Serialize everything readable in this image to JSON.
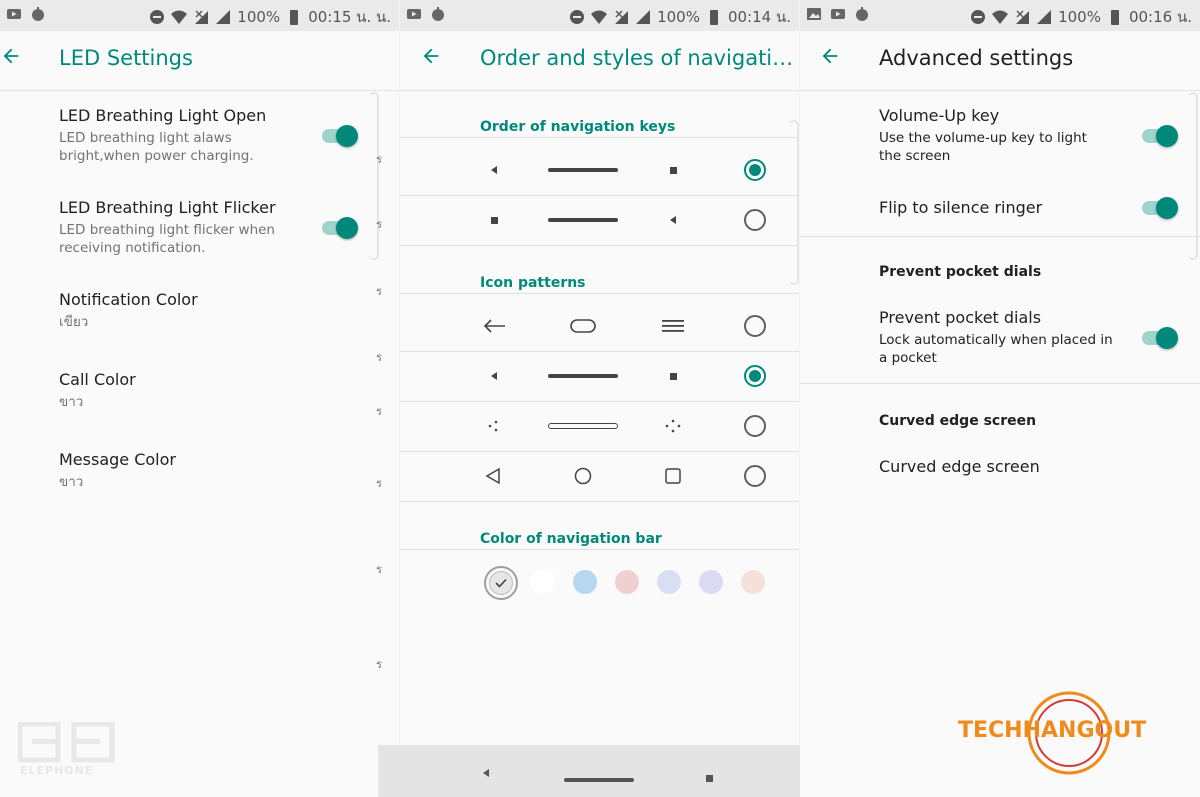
{
  "status_bars": [
    {
      "battery": "100%",
      "time": "00:15 น. น."
    },
    {
      "battery": "100%",
      "time": "00:14 น."
    },
    {
      "battery": "100%",
      "time": "00:16 น."
    }
  ],
  "led_panel": {
    "title": "LED Settings",
    "items": [
      {
        "title": "LED Breathing Light Open",
        "subtitle": "LED breathing light alaws bright,when power charging.",
        "toggle": true
      },
      {
        "title": "LED Breathing Light Flicker",
        "subtitle": "LED breathing light flicker when receiving notification.",
        "toggle": true
      },
      {
        "title": "Notification Color",
        "subtitle": "เขียว"
      },
      {
        "title": "Call Color",
        "subtitle": "ขาว"
      },
      {
        "title": "Message Color",
        "subtitle": "ขาว"
      }
    ],
    "side_marks": [
      "ร",
      "ร",
      "ร",
      "ร",
      "ร",
      "ร",
      "ร",
      "ร"
    ]
  },
  "nav_panel": {
    "title": "Order and styles of navigati…",
    "order_heading": "Order of navigation keys",
    "icon_heading": "Icon patterns",
    "color_heading": "Color of navigation bar",
    "order_options": [
      {
        "selected": true,
        "icons": [
          "triangle-left-small",
          "long-bar",
          "square-small"
        ]
      },
      {
        "selected": false,
        "icons": [
          "square-small",
          "long-bar",
          "triangle-left-small"
        ]
      }
    ],
    "pattern_options": [
      {
        "selected": false,
        "icons": [
          "arrow-left",
          "pill",
          "hamburger"
        ]
      },
      {
        "selected": true,
        "icons": [
          "triangle-left-small",
          "long-bar",
          "square-small"
        ]
      },
      {
        "selected": false,
        "icons": [
          "dots-three",
          "outline-bar",
          "dots-four"
        ]
      },
      {
        "selected": false,
        "icons": [
          "triangle-outline",
          "circle-outline",
          "square-outline"
        ]
      }
    ],
    "colors": [
      "#e8e8e8",
      "#ffffff",
      "#b5d7f2",
      "#eed0d0",
      "#d9dff2",
      "#dcdaf3",
      "#f4e1d9"
    ]
  },
  "advanced_panel": {
    "title": "Advanced settings",
    "items": [
      {
        "title": "Volume-Up key",
        "subtitle": "Use the volume-up key to light the screen",
        "toggle": true
      },
      {
        "title": "Flip to silence ringer",
        "toggle": true
      }
    ],
    "pocket_heading": "Prevent pocket dials",
    "pocket_item": {
      "title": "Prevent pocket dials",
      "subtitle": "Lock automatically when placed in a pocket",
      "toggle": true
    },
    "curved_heading": "Curved edge screen",
    "curved_item": {
      "title": "Curved edge screen"
    }
  },
  "watermarks": {
    "left": "ELEPHONE",
    "right": "TECHHANGOUT"
  },
  "colors": {
    "accent": "#00897b",
    "accent_track": "#9fd4cd",
    "logo_orange": "#f08a1c",
    "logo_red": "#d23b3b"
  }
}
